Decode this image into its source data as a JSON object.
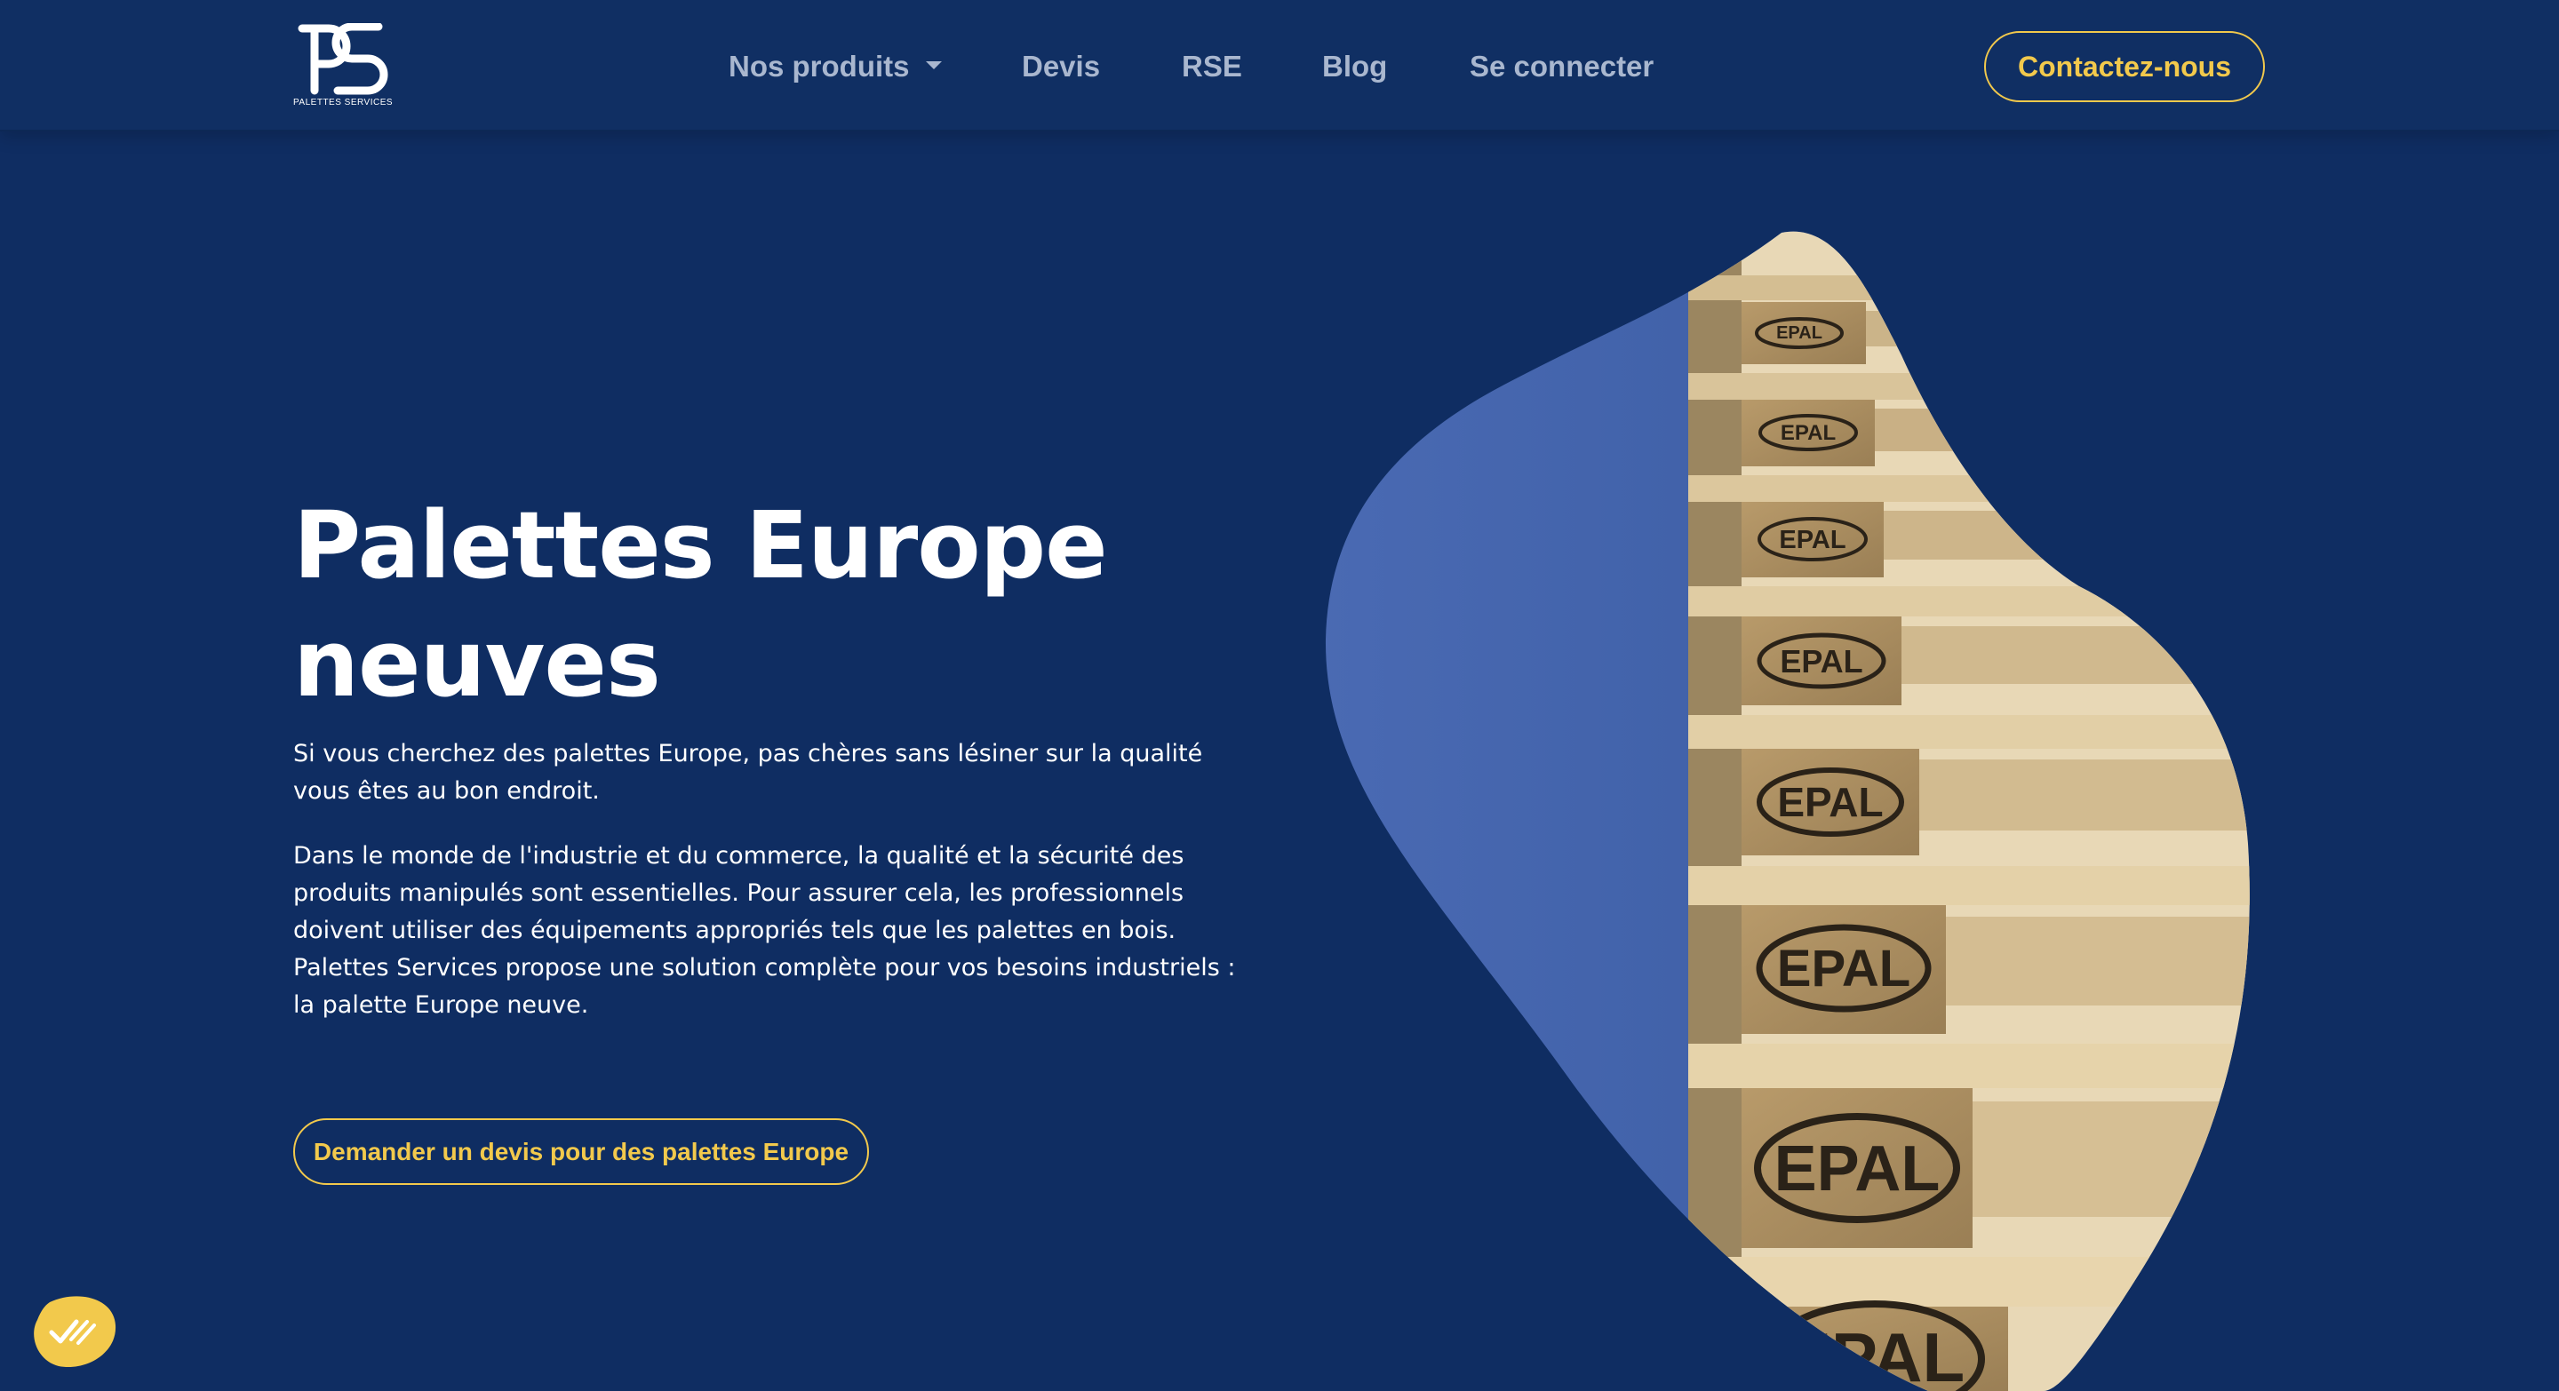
{
  "brand": {
    "name": "PALETTES SERVICES",
    "logo_icon": "ps-monogram-logo",
    "accent_color": "#f2c94c",
    "background_color": "#0f2d62"
  },
  "nav": {
    "items": [
      {
        "label": "Nos produits",
        "has_dropdown": true
      },
      {
        "label": "Devis"
      },
      {
        "label": "RSE"
      },
      {
        "label": "Blog"
      },
      {
        "label": "Se connecter"
      }
    ],
    "contact_label": "Contactez-nous"
  },
  "hero": {
    "title_line1": "Palettes Europe",
    "title_line2": "neuves",
    "paragraph1": "Si vous cherchez des palettes Europe, pas chères sans lésiner sur la qualité vous êtes au bon endroit.",
    "paragraph2": "Dans le monde de l'industrie et du commerce, la qualité et la sécurité des produits manipulés sont essentielles. Pour assurer cela, les professionnels doivent utiliser des équipements appropriés tels que les palettes en bois. Palettes Services propose une solution complète pour vos besoins industriels : la palette Europe neuve.",
    "cta_label": "Demander un devis pour des palettes Europe",
    "image_stamp": "EPAL"
  },
  "widget": {
    "icon": "checkmark-wave-icon"
  }
}
